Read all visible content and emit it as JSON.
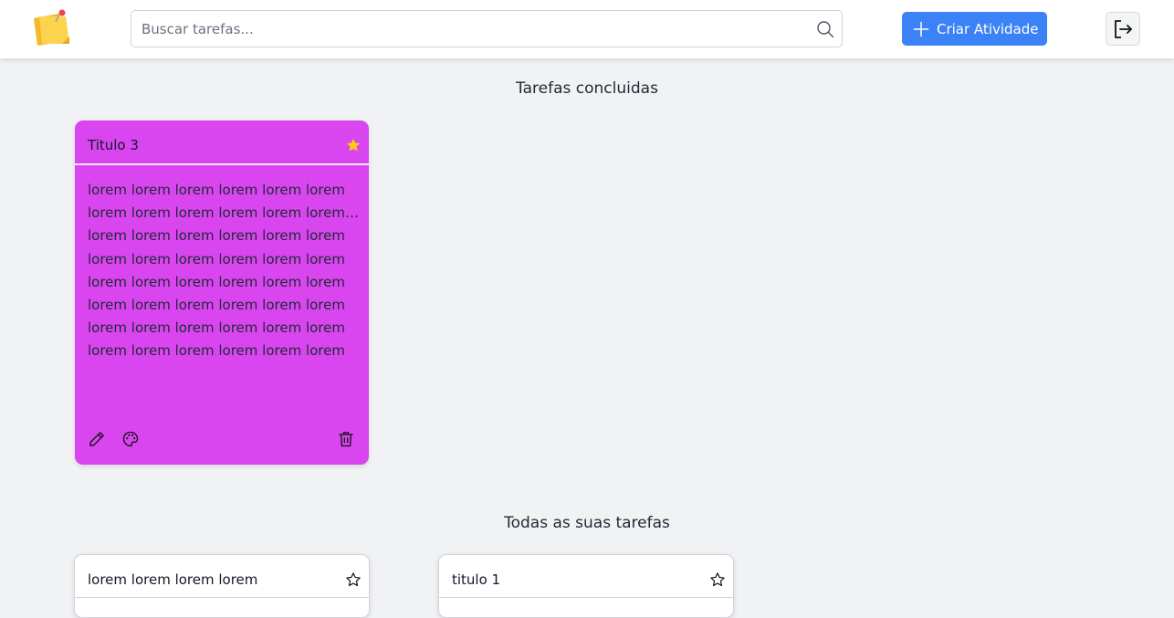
{
  "header": {
    "search_placeholder": "Buscar tarefas...",
    "create_button": "Criar Atividade",
    "icons": {
      "logo": "sticky-note-logo",
      "search": "search-icon",
      "add": "plus-icon",
      "logout": "logout-icon"
    },
    "colors": {
      "accent": "#3b82f6"
    }
  },
  "sections": {
    "completed_title": "Tarefas concluidas",
    "all_title": "Todas as suas tarefas"
  },
  "completed_tasks": [
    {
      "title": "Titulo 3",
      "favorite": true,
      "color": "#d946ef",
      "body_lines": [
        "lorem lorem lorem lorem lorem lorem",
        "lorem lorem lorem lorem lorem lorem lorem lorem",
        "lorem lorem lorem lorem lorem lorem",
        "lorem lorem lorem lorem lorem lorem",
        "lorem lorem lorem lorem lorem lorem",
        "lorem lorem lorem lorem lorem lorem",
        "lorem lorem lorem lorem lorem lorem",
        "lorem lorem lorem lorem lorem lorem"
      ],
      "actions": [
        "pencil-icon",
        "palette-icon",
        "trash-icon"
      ]
    }
  ],
  "all_tasks": [
    {
      "title": "lorem lorem lorem lorem",
      "favorite": false,
      "color": "#ffffff"
    },
    {
      "title": "titulo 1",
      "favorite": false,
      "color": "#ffffff"
    }
  ]
}
